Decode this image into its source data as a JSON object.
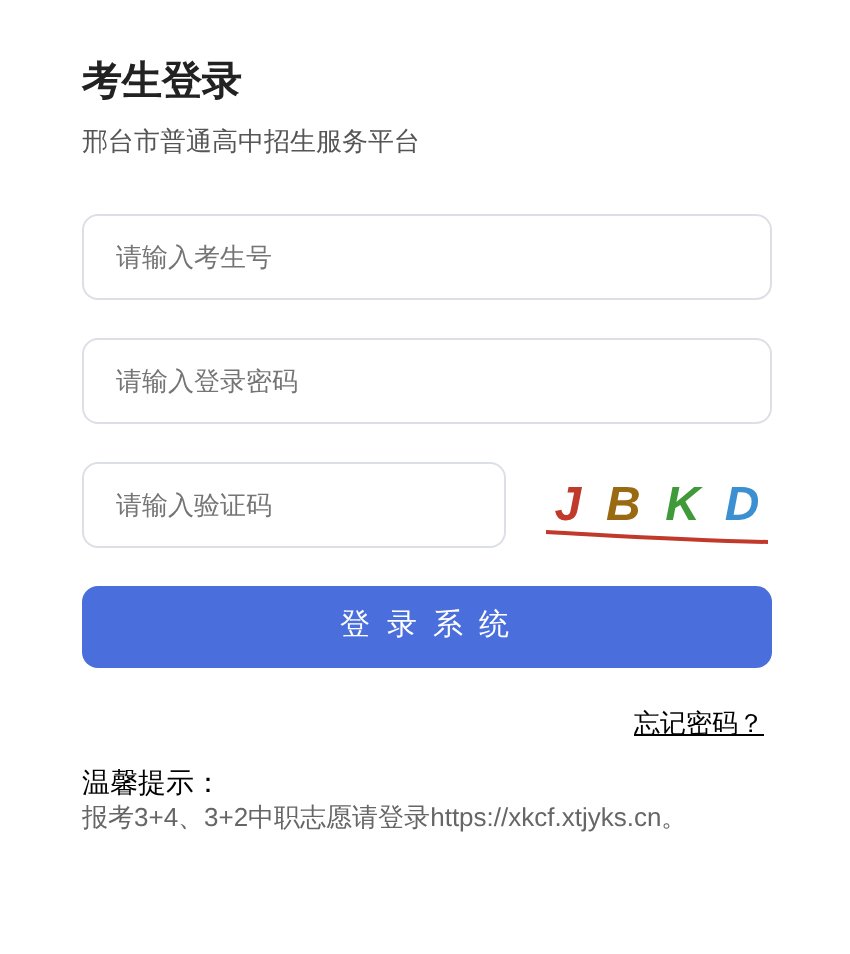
{
  "title": "考生登录",
  "subtitle": "邢台市普通高中招生服务平台",
  "fields": [
    {
      "placeholder": "请输入考生号"
    },
    {
      "placeholder": "请输入登录密码"
    }
  ],
  "captcha_field": {
    "placeholder": "请输入验证码"
  },
  "captcha": [
    {
      "char": "J",
      "color": "#c0392b"
    },
    {
      "char": "B",
      "color": "#9a6a12"
    },
    {
      "char": "K",
      "color": "#3f9a3a"
    },
    {
      "char": "D",
      "color": "#3c8fd0"
    }
  ],
  "login_button": "登 录 系 统",
  "forgot_link": "忘记密码？",
  "notice": {
    "title": "温馨提示：",
    "text": "报考3+4、3+2中职志愿请登录https://xkcf.xtjyks.cn。"
  }
}
